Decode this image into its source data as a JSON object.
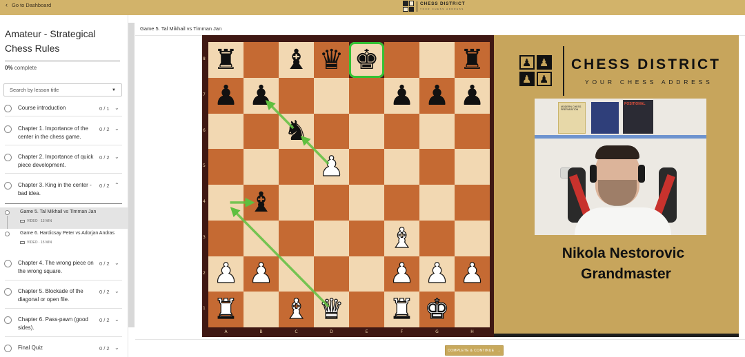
{
  "topbar": {
    "back_label": "Go to Dashboard",
    "brand_name": "CHESS DISTRICT",
    "brand_tagline": "YOUR CHESS ADDRESS"
  },
  "sidebar": {
    "course_title": "Amateur - Strategical Chess Rules",
    "progress_percent": "0%",
    "progress_suffix": " complete",
    "search_placeholder": "Search by lesson title",
    "lessons": [
      {
        "label": "Course introduction",
        "count": "0 / 1",
        "expanded": false
      },
      {
        "label": "Chapter 1. Importance of the center in the chess game.",
        "count": "0 / 2",
        "expanded": false
      },
      {
        "label": "Chapter 2. Importance of quick piece development.",
        "count": "0 / 2",
        "expanded": false
      },
      {
        "label": "Chapter 3. King in the center - bad idea.",
        "count": "0 / 2",
        "expanded": true
      },
      {
        "label": "Chapter 4. The wrong piece on the wrong square.",
        "count": "0 / 2",
        "expanded": false
      },
      {
        "label": "Chapter 5. Blockade of the diagonal or open file.",
        "count": "0 / 2",
        "expanded": false
      },
      {
        "label": "Chapter 6. Pass-pawn (good sides).",
        "count": "0 / 2",
        "expanded": false
      },
      {
        "label": "Final Quiz",
        "count": "0 / 2",
        "expanded": false
      }
    ],
    "sub_lessons": [
      {
        "title": "Game 5. Tal Mikhail vs Timman Jan",
        "meta": "VIDEO · 13 MIN",
        "active": true
      },
      {
        "title": "Game 6. Hardicsay Peter vs Adorjan Andras",
        "meta": "VIDEO · 15 MIN",
        "active": false
      }
    ]
  },
  "main": {
    "lesson_title": "Game 5. Tal Mikhail vs Timman Jan",
    "complete_button": "COMPLETE & CONTINUE",
    "complete_arrow": "→"
  },
  "board": {
    "files": [
      "A",
      "B",
      "C",
      "D",
      "E",
      "F",
      "G",
      "H"
    ],
    "ranks": [
      "8",
      "7",
      "6",
      "5",
      "4",
      "3",
      "2",
      "1"
    ],
    "highlight_square": "e8",
    "pieces": [
      {
        "square": "a8",
        "piece": "rook",
        "color": "b"
      },
      {
        "square": "c8",
        "piece": "bishop",
        "color": "b"
      },
      {
        "square": "d8",
        "piece": "queen",
        "color": "b"
      },
      {
        "square": "e8",
        "piece": "king",
        "color": "b"
      },
      {
        "square": "h8",
        "piece": "rook",
        "color": "b"
      },
      {
        "square": "a7",
        "piece": "pawn",
        "color": "b"
      },
      {
        "square": "b7",
        "piece": "pawn",
        "color": "b"
      },
      {
        "square": "f7",
        "piece": "pawn",
        "color": "b"
      },
      {
        "square": "g7",
        "piece": "pawn",
        "color": "b"
      },
      {
        "square": "h7",
        "piece": "pawn",
        "color": "b"
      },
      {
        "square": "c6",
        "piece": "knight",
        "color": "b"
      },
      {
        "square": "d5",
        "piece": "pawn",
        "color": "w"
      },
      {
        "square": "b4",
        "piece": "bishop",
        "color": "b"
      },
      {
        "square": "f3",
        "piece": "bishop",
        "color": "w"
      },
      {
        "square": "a2",
        "piece": "pawn",
        "color": "w"
      },
      {
        "square": "b2",
        "piece": "pawn",
        "color": "w"
      },
      {
        "square": "f2",
        "piece": "pawn",
        "color": "w"
      },
      {
        "square": "g2",
        "piece": "pawn",
        "color": "w"
      },
      {
        "square": "h2",
        "piece": "pawn",
        "color": "w"
      },
      {
        "square": "a1",
        "piece": "rook",
        "color": "w"
      },
      {
        "square": "c1",
        "piece": "bishop",
        "color": "w"
      },
      {
        "square": "d1",
        "piece": "queen",
        "color": "w"
      },
      {
        "square": "f1",
        "piece": "rook",
        "color": "w"
      },
      {
        "square": "g1",
        "piece": "king",
        "color": "w"
      }
    ],
    "arrows": [
      {
        "from": "d5",
        "to": "c6"
      },
      {
        "from": "c6",
        "to": "b7"
      },
      {
        "from": "d1",
        "to": "a4"
      },
      {
        "from": "a4",
        "to": "b4"
      }
    ],
    "arrow_color": "#5fbf3f"
  },
  "video": {
    "brand_name": "CHESS DISTRICT",
    "brand_tagline": "YOUR CHESS ADDRESS",
    "presenter_name": "Nikola Nestorovic",
    "presenter_title": "Grandmaster",
    "book_titles": [
      "MODERN CHESS PREPARATION",
      "",
      "POSITIONAL"
    ],
    "background_color": "#c7a55c"
  }
}
